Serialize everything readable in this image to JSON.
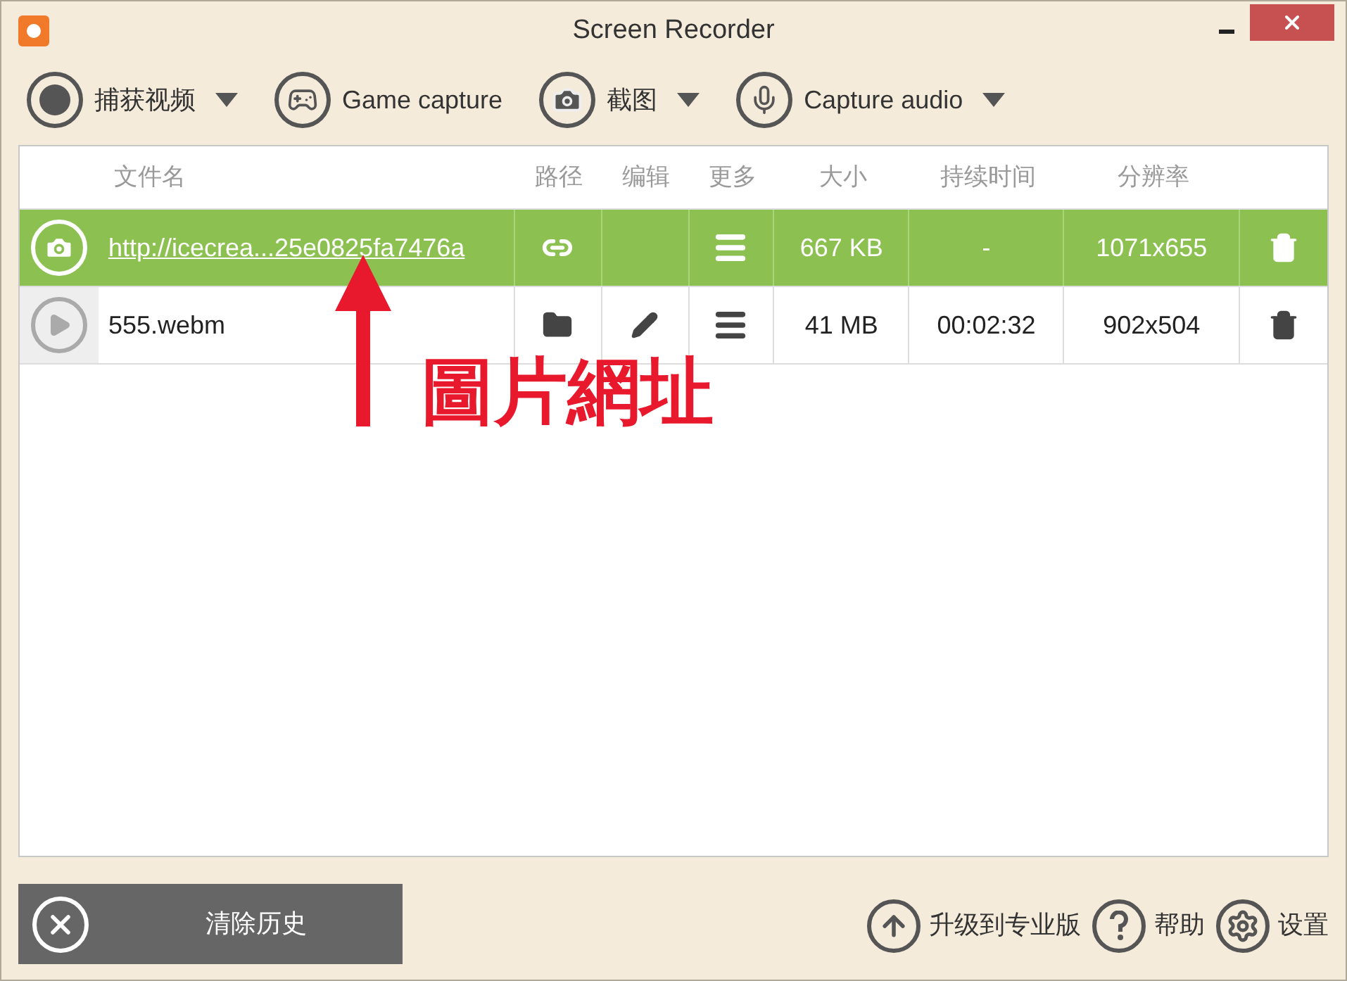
{
  "window": {
    "title": "Screen Recorder"
  },
  "toolbar": [
    {
      "label": "捕获视频",
      "kind": "record",
      "dropdown": true
    },
    {
      "label": "Game capture",
      "kind": "game",
      "dropdown": false
    },
    {
      "label": "截图",
      "kind": "screenshot",
      "dropdown": true
    },
    {
      "label": "Capture audio",
      "kind": "audio",
      "dropdown": true
    }
  ],
  "table": {
    "columns": [
      "文件名",
      "路径",
      "编辑",
      "更多",
      "大小",
      "持续时间",
      "分辨率"
    ],
    "rows": [
      {
        "kind": "image",
        "selected": true,
        "name": "http://icecrea...25e0825fa7476a",
        "size": "667 KB",
        "duration": "-",
        "resolution": "1071x655"
      },
      {
        "kind": "video",
        "selected": false,
        "name": "555.webm",
        "size": "41 MB",
        "duration": "00:02:32",
        "resolution": "902x504"
      }
    ]
  },
  "annotation": {
    "text": "圖片網址"
  },
  "footer": {
    "clear_button": "清除历史",
    "links": [
      {
        "label": "升级到专业版",
        "kind": "upgrade"
      },
      {
        "label": "帮助",
        "kind": "help"
      },
      {
        "label": "设置",
        "kind": "settings"
      }
    ]
  }
}
